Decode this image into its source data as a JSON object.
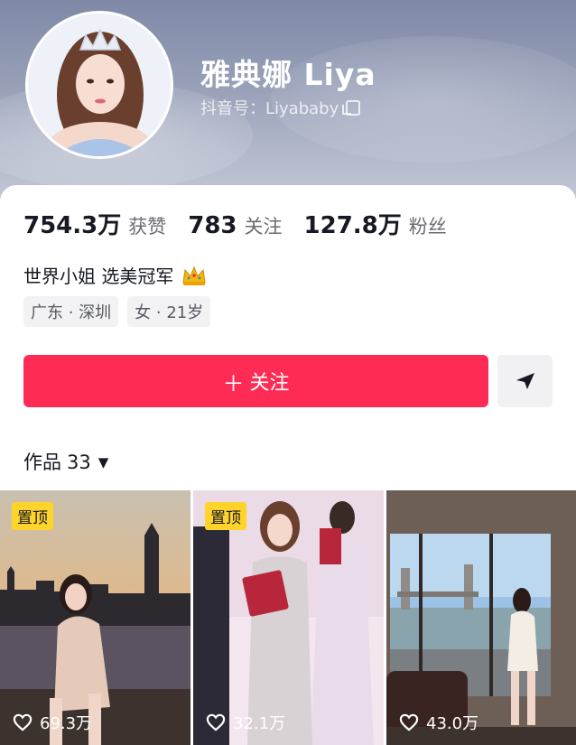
{
  "profile": {
    "name": "雅典娜 Liya",
    "douyin_id": "抖音号：Liyababy"
  },
  "stats": [
    {
      "value": "754.3万",
      "label": "获赞"
    },
    {
      "value": "783",
      "label": "关注"
    },
    {
      "value": "127.8万",
      "label": "粉丝"
    }
  ],
  "bio": "世界小姐 选美冠军",
  "tags": [
    "广东 · 深圳",
    "女 · 21岁"
  ],
  "actions": {
    "follow_label": "关注",
    "follow_color": "#fe2c55"
  },
  "works": {
    "label": "作品",
    "count": "33"
  },
  "videos": [
    {
      "pinned_label": "置顶",
      "likes": "69.3万"
    },
    {
      "pinned_label": "置顶",
      "likes": "32.1万"
    },
    {
      "likes": "43.0万"
    }
  ]
}
